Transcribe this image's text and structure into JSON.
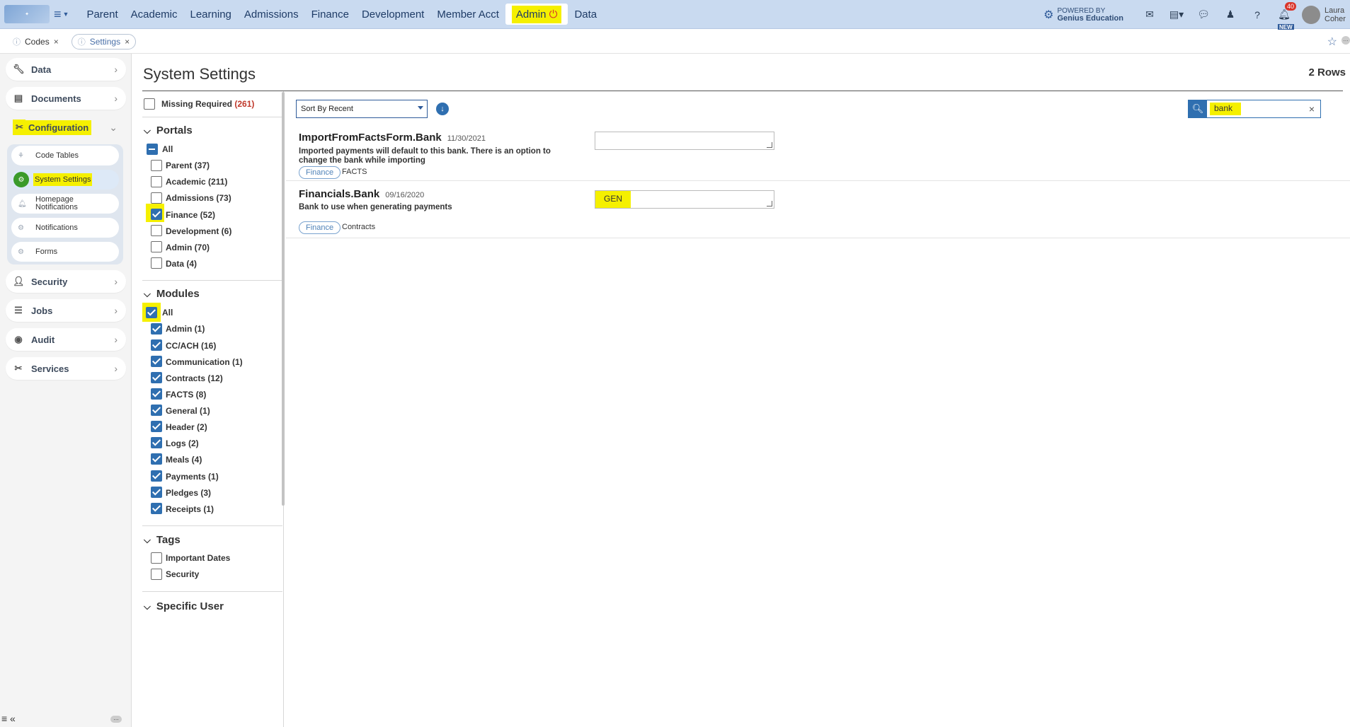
{
  "topbar": {
    "nav": [
      "Parent",
      "Academic",
      "Learning",
      "Admissions",
      "Finance",
      "Development",
      "Member Acct",
      "Admin",
      "Data"
    ],
    "powered_line1": "POWERED BY",
    "powered_line2": "Genius Education",
    "notif_count": "40",
    "new_label": "NEW",
    "user_name": "Laura Coher"
  },
  "tabs": {
    "codes": "Codes",
    "settings": "Settings"
  },
  "sidebar": {
    "data": "Data",
    "documents": "Documents",
    "configuration": "Configuration",
    "code_tables": "Code Tables",
    "system_settings": "System Settings",
    "homepage_notifications_1": "Homepage",
    "homepage_notifications_2": "Notifications",
    "notifications": "Notifications",
    "forms": "Forms",
    "security": "Security",
    "jobs": "Jobs",
    "audit": "Audit",
    "services": "Services"
  },
  "page": {
    "title": "System Settings",
    "row_count": "2 Rows"
  },
  "filters": {
    "missing_required": "Missing Required",
    "missing_required_count": "(261)",
    "portals_heading": "Portals",
    "portals": [
      "All",
      "Parent (37)",
      "Academic (211)",
      "Admissions (73)",
      "Finance (52)",
      "Development (6)",
      "Admin (70)",
      "Data (4)"
    ],
    "modules_heading": "Modules",
    "modules": [
      "All",
      "Admin (1)",
      "CC/ACH (16)",
      "Communication (1)",
      "Contracts (12)",
      "FACTS (8)",
      "General (1)",
      "Header (2)",
      "Logs (2)",
      "Meals (4)",
      "Payments (1)",
      "Pledges (3)",
      "Receipts (1)"
    ],
    "tags_heading": "Tags",
    "tags": [
      "Important Dates",
      "Security"
    ],
    "specific_user_heading": "Specific User"
  },
  "toolbar": {
    "sort_value": "Sort By Recent",
    "search_value": "bank"
  },
  "records": [
    {
      "name": "ImportFromFactsForm.Bank",
      "date": "11/30/2021",
      "description": "Imported payments will default to this bank. There is an option to change the bank while importing",
      "tag": "Finance",
      "module": "FACTS",
      "value": ""
    },
    {
      "name": "Financials.Bank",
      "date": "09/16/2020",
      "description": "Bank to use when generating payments",
      "tag": "Finance",
      "module": "Contracts",
      "value": "GEN"
    }
  ]
}
